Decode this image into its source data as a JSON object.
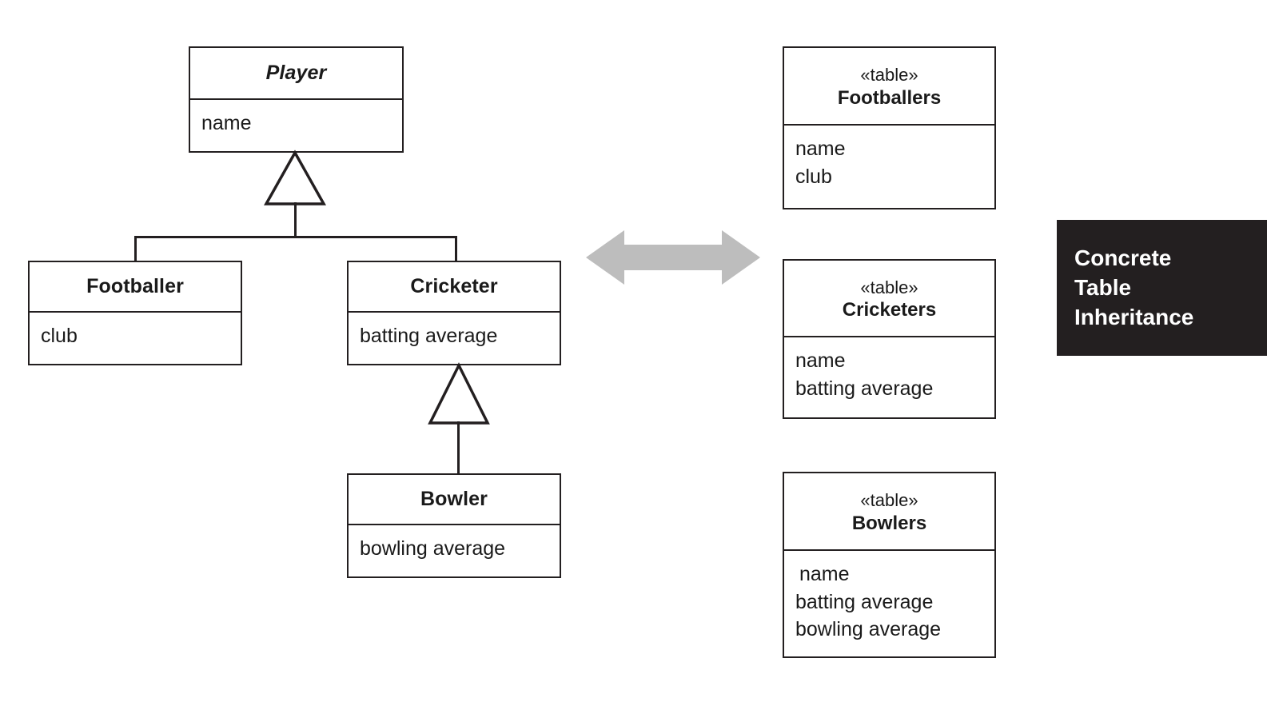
{
  "diagram": {
    "caption": {
      "lines": [
        "Concrete",
        "Table",
        "Inheritance"
      ],
      "background_color": "#231f20",
      "text_color": "#ffffff"
    },
    "relationship_arrow": {
      "name": "maps-to-double-arrow",
      "direction": "bidirectional",
      "color": "#bdbdbd"
    },
    "classes": [
      {
        "id": "player",
        "name": "Player",
        "abstract": true,
        "attributes": [
          "name"
        ]
      },
      {
        "id": "footballer",
        "name": "Footballer",
        "abstract": false,
        "attributes": [
          "club"
        ]
      },
      {
        "id": "cricketer",
        "name": "Cricketer",
        "abstract": false,
        "attributes": [
          "batting average"
        ]
      },
      {
        "id": "bowler",
        "name": "Bowler",
        "abstract": false,
        "attributes": [
          "bowling average"
        ]
      }
    ],
    "generalizations": [
      {
        "child": "Footballer",
        "parent": "Player"
      },
      {
        "child": "Cricketer",
        "parent": "Player"
      },
      {
        "child": "Bowler",
        "parent": "Cricketer"
      }
    ],
    "tables": [
      {
        "id": "footballers",
        "stereotype": "«table»",
        "name": "Footballers",
        "columns": [
          "name",
          "club"
        ]
      },
      {
        "id": "cricketers",
        "stereotype": "«table»",
        "name": "Cricketers",
        "columns": [
          "name",
          "batting average"
        ]
      },
      {
        "id": "bowlers",
        "stereotype": "«table»",
        "name": "Bowlers",
        "columns": [
          "name",
          "batting average",
          "bowling average"
        ]
      }
    ]
  }
}
